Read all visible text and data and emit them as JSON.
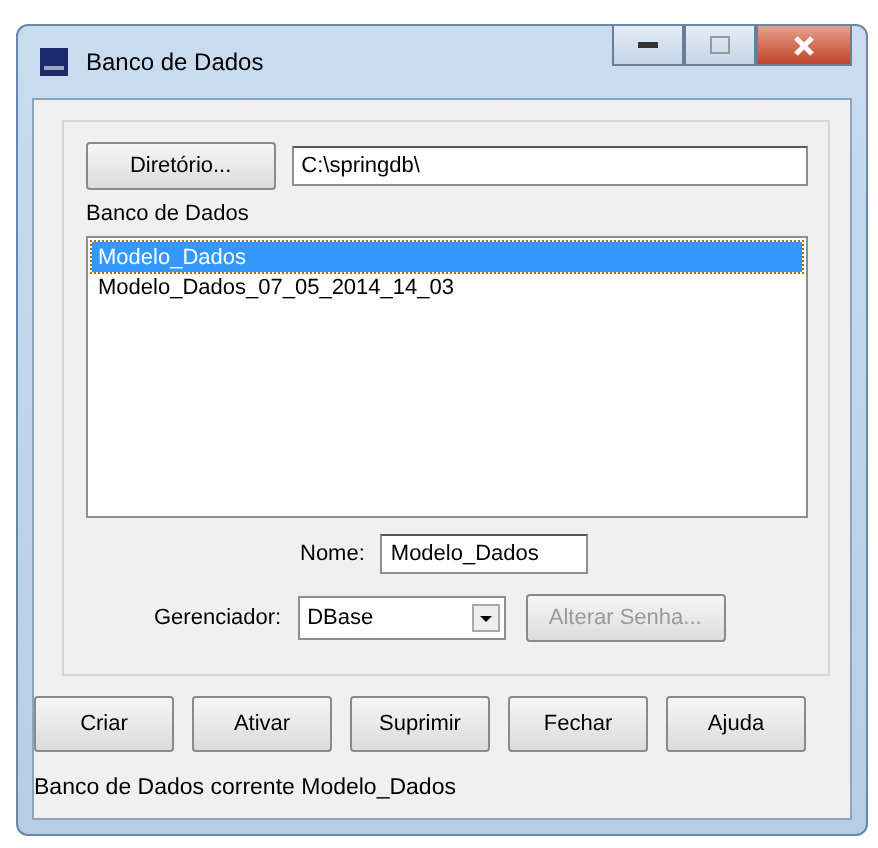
{
  "window": {
    "title": "Banco de Dados"
  },
  "directory_button": "Diretório...",
  "path": "C:\\springdb\\",
  "list_label": "Banco de Dados",
  "databases": [
    {
      "name": "Modelo_Dados",
      "selected": true
    },
    {
      "name": "Modelo_Dados_07_05_2014_14_03",
      "selected": false
    }
  ],
  "name_label": "Nome:",
  "name_value": "Modelo_Dados",
  "manager_label": "Gerenciador:",
  "manager_value": "DBase",
  "change_password": {
    "label": "Alterar Senha...",
    "disabled": true
  },
  "buttons": [
    "Criar",
    "Ativar",
    "Suprimir",
    "Fechar",
    "Ajuda"
  ],
  "status_bar": "Banco de Dados corrente Modelo_Dados"
}
